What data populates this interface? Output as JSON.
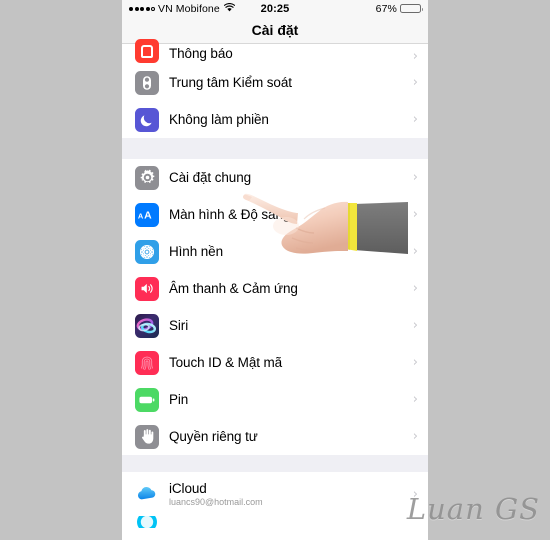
{
  "status_bar": {
    "signal_dots_filled": 4,
    "signal_dots_hollow": 1,
    "carrier": "VN Mobifone",
    "wifi_icon": "wifi-icon",
    "time": "20:25",
    "battery_percent": "67%",
    "battery_level": 67,
    "battery_color": "#ffcc00"
  },
  "navbar": {
    "title": "Cài đặt"
  },
  "watermark": {
    "text": "Luan GS"
  },
  "cursor": {
    "type": "pointing-hand",
    "sleeve_color": "#6e6e6e",
    "cuff_color": "#f2e63c"
  },
  "groups": [
    {
      "id": "group-notifications",
      "rows": [
        {
          "name": "notifications",
          "label": "Thông báo",
          "icon": "notifications-icon",
          "partial": true
        },
        {
          "name": "control-center",
          "label": "Trung tâm Kiểm soát",
          "icon": "control-center-icon"
        },
        {
          "name": "do-not-disturb",
          "label": "Không làm phiền",
          "icon": "do-not-disturb-icon"
        }
      ]
    },
    {
      "id": "group-general",
      "rows": [
        {
          "name": "general",
          "label": "Cài đặt chung",
          "icon": "gear-icon"
        },
        {
          "name": "display-brightness",
          "label": "Màn hình & Độ sáng",
          "icon": "display-text-size-icon"
        },
        {
          "name": "wallpaper",
          "label": "Hình nền",
          "icon": "wallpaper-icon"
        },
        {
          "name": "sounds-haptics",
          "label": "Âm thanh & Cảm ứng",
          "icon": "speaker-icon"
        },
        {
          "name": "siri",
          "label": "Siri",
          "icon": "siri-icon"
        },
        {
          "name": "touch-id-passcode",
          "label": "Touch ID & Mật mã",
          "icon": "fingerprint-icon"
        },
        {
          "name": "battery",
          "label": "Pin",
          "icon": "battery-icon"
        },
        {
          "name": "privacy",
          "label": "Quyền riêng tư",
          "icon": "hand-privacy-icon"
        }
      ]
    },
    {
      "id": "group-icloud",
      "rows": [
        {
          "name": "icloud",
          "label": "iCloud",
          "sub": "luancs90@hotmail.com",
          "icon": "icloud-icon"
        }
      ]
    }
  ],
  "chevron_glyph": "›"
}
